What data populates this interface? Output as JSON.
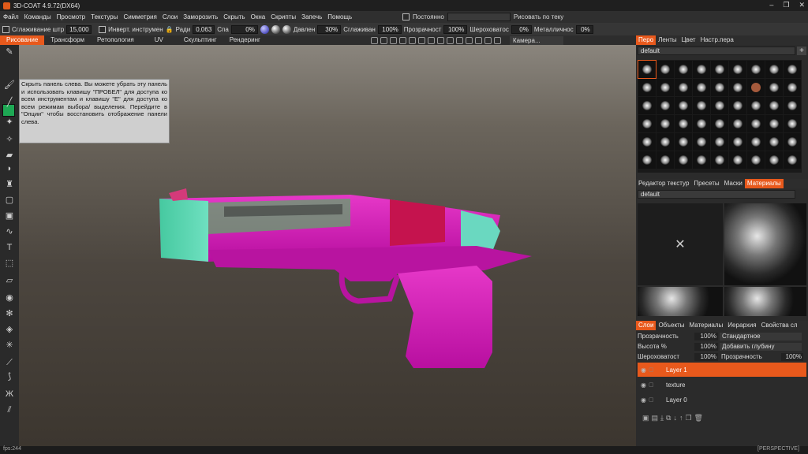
{
  "window": {
    "title": "3D-COAT 4.9.72(DX64)",
    "controls": [
      "–",
      "❐",
      "✕"
    ]
  },
  "menu": {
    "items": [
      "Файл",
      "Команды",
      "Просмотр",
      "Текстуры",
      "Симметрия",
      "Слои",
      "Заморозить",
      "Скрыть",
      "Окна",
      "Скрипты",
      "Запечь",
      "Помощь"
    ],
    "constant_label": "Постоянно",
    "paint_mode": "Рисовать по теку"
  },
  "toolbar": {
    "smooth_label": "Сглаживание штр",
    "smooth_value": "15,000",
    "invert_label": "Инверт. инструмен",
    "radius_label": "Ради",
    "radius_value": "0,063",
    "spa_label": "Спа",
    "spa_value": "0%",
    "pressure_label": "Давлен",
    "pressure_value": "30%",
    "smooth2_label": "Сглаживан",
    "smooth2_value": "100%",
    "opacity_label": "Прозрачност",
    "opacity_value": "100%",
    "rough_label": "Шероховатос",
    "rough_value": "0%",
    "metal_label": "Металличнос",
    "metal_value": "0%"
  },
  "room_tabs": [
    "Рисование",
    "Трансформ",
    "Ретопология",
    "UV",
    "Скульптинг",
    "Рендеринг"
  ],
  "camera_label": "Камера...",
  "tooltip": "Скрыть панель слева. Вы можете убрать эту панель и использовать клавишу \"ПРОБЕЛ\" для доступа ко всем инструментам и клавишу \"E\" для доступа ко всем режимам выбора/ выделения. Перейдите в \"Опции\" чтобы восстановить отображение панели слева.",
  "colors": {
    "accent": "#e8591c",
    "primary_color": "#1ea854"
  },
  "status": {
    "fps": "fps:244",
    "view": "[PERSPECTIVE]"
  },
  "brush_panel": {
    "tabs": [
      "Перо",
      "Ленты",
      "Цвет",
      "Настр.пера"
    ],
    "preset": "default"
  },
  "materials_panel": {
    "tabs": [
      "Редактор текстур",
      "Пресеты",
      "Маски",
      "Материалы"
    ],
    "preset": "default"
  },
  "layers_panel": {
    "tabs": [
      "Слои",
      "Объекты",
      "Материалы",
      "Иерархия",
      "Свойства сл"
    ],
    "opacity_label": "Прозрачность",
    "opacity_value": "100%",
    "blend_mode": "Стандартное",
    "height_label": "Высота  %",
    "height_value": "100%",
    "height_mode": "Добавить глубину",
    "rough_label": "Шероховатост",
    "rough_value": "100%",
    "opacity2_label": "Прозрачность",
    "opacity2_value": "100%",
    "layers": [
      "Layer 1",
      "texture",
      "Layer 0"
    ]
  }
}
